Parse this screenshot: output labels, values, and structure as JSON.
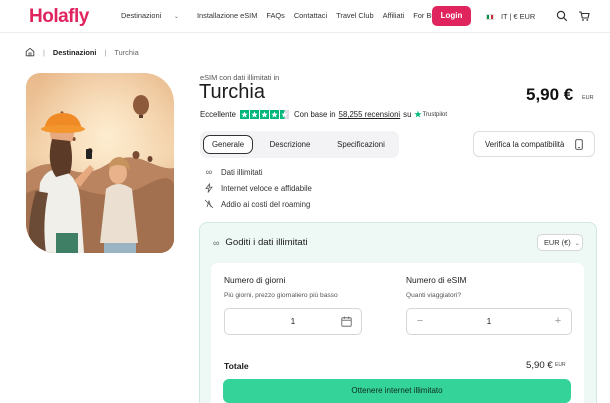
{
  "header": {
    "logo": "Holafly",
    "nav": [
      "Destinazioni",
      "Installazione eSIM",
      "FAQs",
      "Contattaci",
      "Travel Club",
      "Affiliati",
      "For Business"
    ],
    "login_label": "Login",
    "locale": "IT | € EUR"
  },
  "breadcrumb": {
    "items": [
      "Destinazioni",
      "Turchia"
    ]
  },
  "product": {
    "subtitle": "eSIM con dati illimitati in",
    "title": "Turchia",
    "price": "5,90 €",
    "price_currency": "EUR",
    "rating_label": "Eccellente",
    "rating_stars": 4.5,
    "reviews_prefix": "Con base in",
    "reviews_count": "58,255 recensioni",
    "reviews_suffix": "su",
    "trustpilot": "Trustpilot"
  },
  "tabs": [
    "Generale",
    "Descrizione",
    "Specificazioni"
  ],
  "compat_button": "Verifica la compatibilità",
  "features": [
    "Dati illimitati",
    "Internet veloce e affidabile",
    "Addio ai costi del roaming"
  ],
  "card": {
    "title": "Goditi i dati illimitati",
    "currency_select": "EUR (€)",
    "days_label": "Numero di giorni",
    "days_hint": "Più giorni, prezzo giornaliero più basso",
    "days_value": "1",
    "esim_label": "Numero di eSIM",
    "esim_hint": "Quanti viaggiatori?",
    "esim_value": "1",
    "total_label": "Totale",
    "total_value": "5,90 €",
    "total_currency": "EUR",
    "cta_label": "Ottenere internet illimitato"
  },
  "colors": {
    "brand": "#e0245e",
    "cta": "#34d399",
    "trustpilot": "#00b67a"
  }
}
